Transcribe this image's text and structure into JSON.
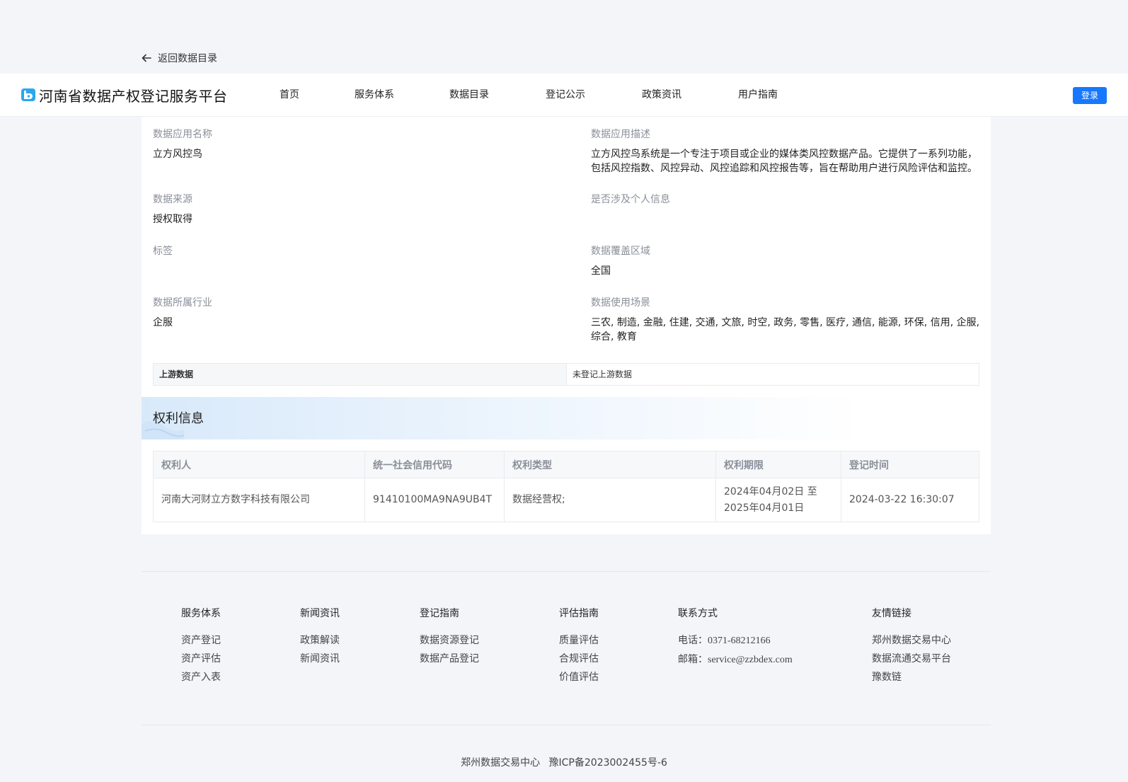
{
  "back_link": "返回数据目录",
  "brand": {
    "name": "河南省数据产权登记服务平台",
    "logo_icon": "data-registry-logo-icon",
    "accent": "#1677ff"
  },
  "nav": {
    "items": [
      "首页",
      "服务体系",
      "数据目录",
      "登记公示",
      "政策资讯",
      "用户指南"
    ],
    "login": "登录"
  },
  "fields": {
    "app_name": {
      "label": "数据应用名称",
      "value": "立方风控鸟"
    },
    "app_desc": {
      "label": "数据应用描述",
      "value": "立方风控鸟系统是一个专注于项目或企业的媒体类风控数据产品。它提供了一系列功能，包括风控指数、风控异动、风控追踪和风控报告等，旨在帮助用户进行风险评估和监控。"
    },
    "source": {
      "label": "数据来源",
      "value": "授权取得"
    },
    "personal": {
      "label": "是否涉及个人信息",
      "value": ""
    },
    "tags": {
      "label": "标签",
      "value": ""
    },
    "region": {
      "label": "数据覆盖区域",
      "value": "全国"
    },
    "industry": {
      "label": "数据所属行业",
      "value": "企服"
    },
    "scenario": {
      "label": "数据使用场景",
      "value": "三农, 制造, 金融, 住建, 交通, 文旅, 时空, 政务, 零售, 医疗, 通信, 能源, 环保, 信用, 企服, 综合, 教育"
    }
  },
  "upstream": {
    "label": "上游数据",
    "value": "未登记上游数据"
  },
  "rights": {
    "title": "权利信息",
    "headers": [
      "权利人",
      "统一社会信用代码",
      "权利类型",
      "权利期限",
      "登记时间"
    ],
    "row": {
      "holder": "河南大河财立方数字科技有限公司",
      "code": "91410100MA9NA9UB4T",
      "type": "数据经营权;",
      "period_start": "2024年04月02日 至",
      "period_end": "2025年04月01日",
      "time": "2024-03-22 16:30:07"
    }
  },
  "footer": {
    "service": {
      "title": "服务体系",
      "items": [
        "资产登记",
        "资产评估",
        "资产入表"
      ]
    },
    "news": {
      "title": "新闻资讯",
      "items": [
        "政策解读",
        "新闻资讯"
      ]
    },
    "guide": {
      "title": "登记指南",
      "items": [
        "数据资源登记",
        "数据产品登记"
      ]
    },
    "eval": {
      "title": "评估指南",
      "items": [
        "质量评估",
        "合规评估",
        "价值评估"
      ]
    },
    "contact": {
      "title": "联系方式",
      "phone_label": "电话：",
      "phone": "0371-68212166",
      "email_label": "邮箱：",
      "email": "service@zzbdex.com"
    },
    "links": {
      "title": "友情链接",
      "items": [
        "郑州数据交易中心",
        "数据流通交易平台",
        "豫数链"
      ]
    },
    "org": "郑州数据交易中心",
    "icp": "豫ICP备2023002455号-6"
  }
}
